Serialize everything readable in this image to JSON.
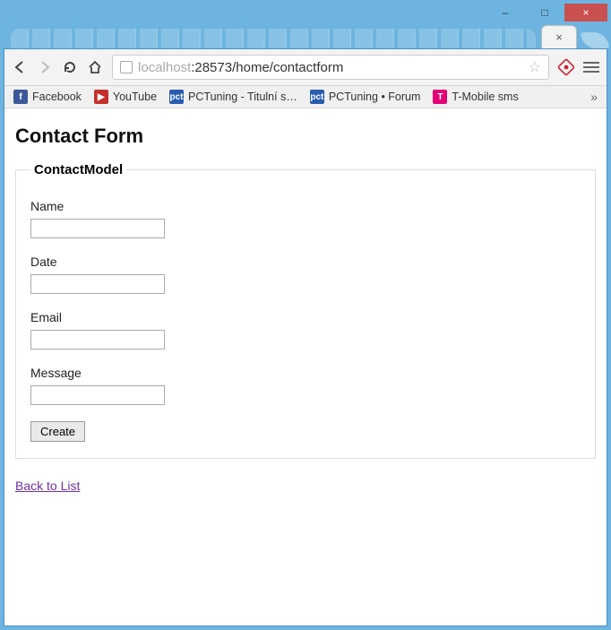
{
  "window": {
    "minimize": "–",
    "maximize": "□",
    "close": "×"
  },
  "tab": {
    "close": "×"
  },
  "omnibox": {
    "host_prefix": "localhost",
    "host_port": ":28573",
    "path": "/home/contactform"
  },
  "bookmarks": {
    "items": [
      {
        "label": "Facebook",
        "icon": "f",
        "cls": "fb"
      },
      {
        "label": "YouTube",
        "icon": "▶",
        "cls": "yt"
      },
      {
        "label": "PCTuning - Titulní s…",
        "icon": "pct",
        "cls": "pct"
      },
      {
        "label": "PCTuning • Forum",
        "icon": "pct",
        "cls": "pct"
      },
      {
        "label": "T-Mobile sms",
        "icon": "T",
        "cls": "tm"
      }
    ],
    "overflow": "»"
  },
  "page": {
    "title": "Contact Form",
    "legend": "ContactModel",
    "fields": [
      {
        "label": "Name",
        "value": ""
      },
      {
        "label": "Date",
        "value": ""
      },
      {
        "label": "Email",
        "value": ""
      },
      {
        "label": "Message",
        "value": ""
      }
    ],
    "submit_label": "Create",
    "back_link": "Back to List"
  }
}
